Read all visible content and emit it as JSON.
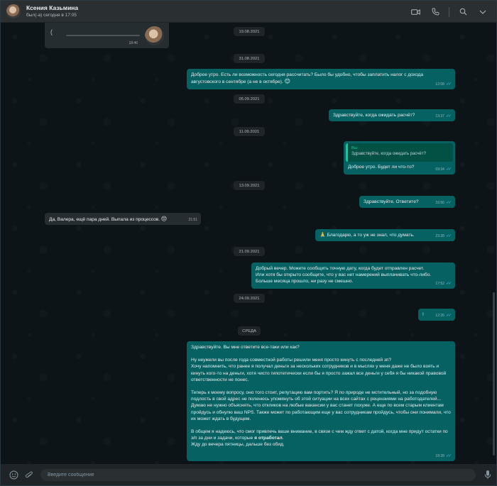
{
  "header": {
    "contact_name": "Ксения Казьмина",
    "status": "был(-а) сегодня в 17:05"
  },
  "chat": {
    "voice_message": {
      "time": "18:46"
    },
    "date_19_08": "19.08.2021",
    "date_31_08": "31.08.2021",
    "msg1": {
      "text": "Доброе утро. Есть ли возможность сегодня рассчитать? Было бы удобно, чтобы заплатить налог с дохода августовского в сентябре (а не в октябре).",
      "emoji": "😊",
      "time": "12:08"
    },
    "date_05_09": "05.09.2021",
    "msg2": {
      "text": "Здравствуйте, когда ожидать расчёт?",
      "time": "13:37"
    },
    "date_11_09": "11.09.2021",
    "msg3": {
      "quote_author": "Вы",
      "quote_text": "Здравствуйте, когда ожидать расчёт?",
      "text": "Доброе утро. Будет ли что-то?",
      "time": "09:34"
    },
    "date_13_09": "13.09.2021",
    "msg4": {
      "text": "Здравствуйте. Ответите?",
      "time": "16:56"
    },
    "msg5": {
      "text": "Да, Валера, ещё пара дней. Выпала из процессов.",
      "emoji": "😔",
      "time": "21:51"
    },
    "msg6": {
      "emoji": "🙏",
      "text": "Благодарю, а то уж не знал, что думать.",
      "time": "23:28"
    },
    "date_21_09": "21.09.2021",
    "msg7": {
      "text": "Добрый вечер. Можете сообщить точную дату, когда будет отправлен расчет.\nИли хотя бы открыто сообщите, что у вас нет намерений выплачивать что-либо.\nБольше месяца прошло, ни разу не смешно.",
      "time": "17:52"
    },
    "date_24_09": "24.09.2021",
    "msg8": {
      "text": "!",
      "time": "12:26"
    },
    "date_wed": "СРЕДА",
    "msg9": {
      "p1": "Здравствуйте. Вы мне ответите все-таки или как?",
      "p2": "Ну неужели вы после года совместной работы решили меня просто кинуть с последней зп?\nХочу напомнить, что ранее я получал деньги за нескольких сотрудников и в мыслях у меня даже не было взять и кинуть кого-то на деньги, хотя чисто гипотетически если бы я просто зажал все деньги у себя я бы никакой правовой ответственности не понес.",
      "p3": "Теперь к моему вопросу, оно того стоит, репутацию вам портить? Я по природе не мстительный, но за подобную подлость в свой адрес не поленюсь упомянуть об этой ситуации на всех сайтах с рецензиями на работодателей... Думаю не нужно объяснять, что откликов на любые вакансии у вас станет похуже. А еще по всем старым клиентам пройдусь и обнулю ваш NPS. Также может по работающим еще у вас сотрудникам пройдусь, чтобы они понимали, что их может ждать в будущем.",
      "p4_start": "В общем я надеюсь, что смог привлечь ваше внимание, в связи с чем жду ответ с датой, когда мне придут остатки по з/п за дни и задачи, которые ",
      "p4_bold": "я отработал",
      "p4_end": ".\nЖду до вечера пятницы, дальше без обид.",
      "time": "18:28"
    }
  },
  "composer": {
    "placeholder": "Введите сообщение"
  },
  "colors": {
    "incoming": "#262d31",
    "outgoing": "#056162",
    "read_ticks": "#53bdeb"
  },
  "icons": [
    "video-call-icon",
    "phone-icon",
    "search-icon",
    "chevron-down-icon",
    "emoji-icon",
    "attach-icon",
    "microphone-icon",
    "play-icon"
  ]
}
